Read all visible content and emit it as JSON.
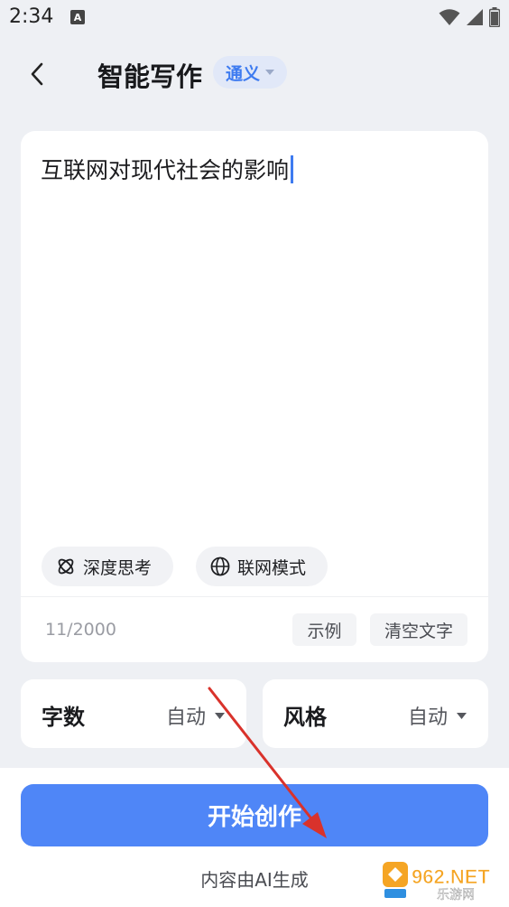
{
  "status_bar": {
    "time": "2:34",
    "notification_glyph": "A",
    "icons": [
      "wifi-icon",
      "signal-icon",
      "battery-icon"
    ]
  },
  "header": {
    "back_icon": "chevron-left-icon",
    "title": "智能写作",
    "model_chip": {
      "label": "通义",
      "icon": "caret-down-icon"
    }
  },
  "editor": {
    "text": "互联网对现代社会的影响",
    "modes": [
      {
        "label": "深度思考",
        "icon": "atom-icon"
      },
      {
        "label": "联网模式",
        "icon": "globe-icon"
      }
    ],
    "word_count": "11/2000",
    "example_label": "示例",
    "clear_label": "清空文字"
  },
  "options": {
    "words": {
      "label": "字数",
      "value": "自动"
    },
    "style": {
      "label": "风格",
      "value": "自动"
    }
  },
  "actions": {
    "start_label": "开始创作",
    "ai_note": "内容由AI生成"
  },
  "watermark": {
    "text": "962.NET",
    "subtext": "乐游网"
  },
  "colors": {
    "accent": "#4f86f7",
    "chip_text": "#3e7bf0",
    "background": "#eef0f4",
    "annotation_arrow": "#d9322b"
  }
}
